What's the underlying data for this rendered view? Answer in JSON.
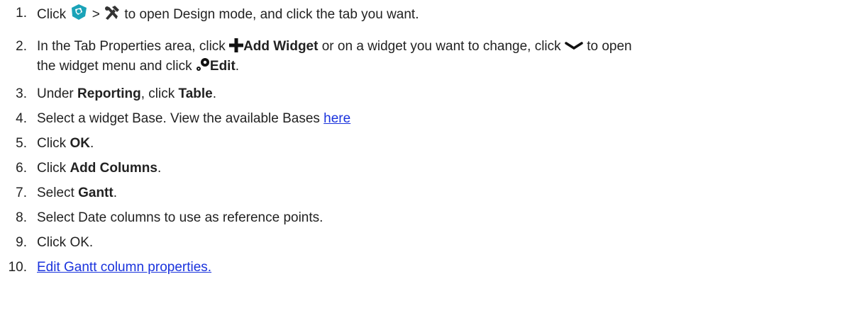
{
  "steps": [
    {
      "num": "1.",
      "p1": "Click",
      "sep": ">",
      "p2": "to open Design mode, and click the tab you want.",
      "icon_a": "app-menu-icon",
      "icon_b": "design-tools-icon"
    },
    {
      "num": "2.",
      "p1": "In the Tab Properties area, click",
      "b1": "Add Widget",
      "p2": "or on a widget you want to change, click",
      "p3": "to open",
      "line2a": "the widget menu and click",
      "b2": "Edit",
      "line2b": ".",
      "icon_a": "plus-icon",
      "icon_b": "chevron-down-icon",
      "icon_c": "gear-icon"
    },
    {
      "num": "3.",
      "p1": "Under",
      "b1": "Reporting",
      "p2": ", click",
      "b2": "Table",
      "p3": "."
    },
    {
      "num": "4.",
      "p1": "Select a widget Base. View the available Bases",
      "link": "here"
    },
    {
      "num": "5.",
      "p1": "Click",
      "b1": "OK",
      "p2": "."
    },
    {
      "num": "6.",
      "p1": "Click",
      "b1": "Add Columns",
      "p2": "."
    },
    {
      "num": "7.",
      "p1": "Select",
      "b1": "Gantt",
      "p2": "."
    },
    {
      "num": "8.",
      "p1": "Select Date columns to use as reference points."
    },
    {
      "num": "9.",
      "p1": "Click OK."
    },
    {
      "num": "10.",
      "link": "Edit Gantt column properties."
    }
  ],
  "colors": {
    "text": "#222222",
    "link": "#1a33dd",
    "icon_teal": "#1aa3b8"
  }
}
